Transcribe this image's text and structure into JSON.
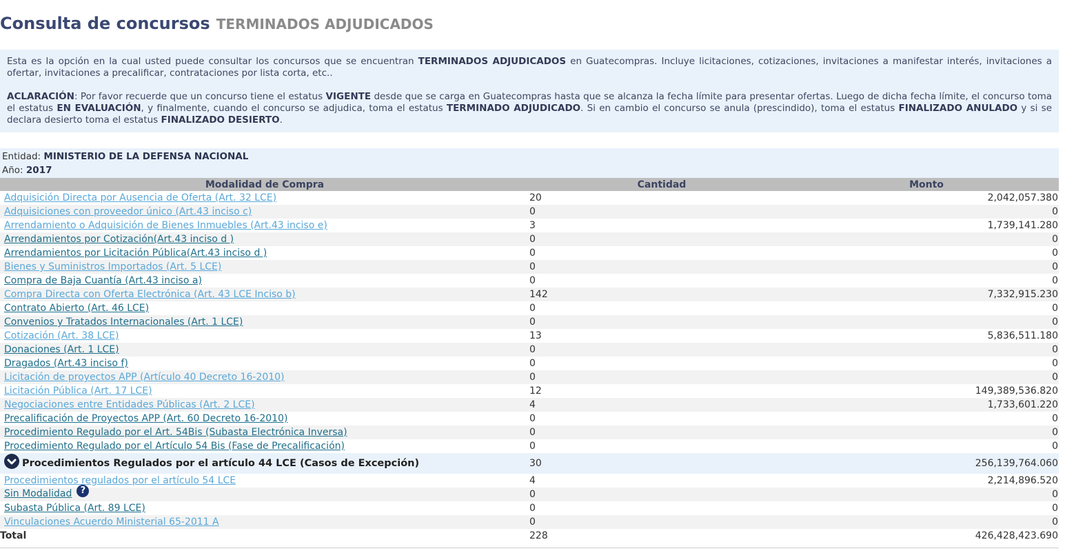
{
  "header": {
    "title": "Consulta de concursos",
    "subtitle": "TERMINADOS ADJUDICADOS"
  },
  "info": {
    "p1_a": "Esta es la opción en la cual usted puede consultar los concursos que se encuentran ",
    "p1_b": "TERMINADOS ADJUDICADOS",
    "p1_c": " en Guatecompras. Incluye licitaciones, cotizaciones, invitaciones a manifestar interés, invitaciones a ofertar, invitaciones a precalificar, contrataciones por lista corta, etc..",
    "p2_a": "ACLARACIÓN",
    "p2_b": ": Por favor recuerde que un concurso tiene el estatus ",
    "p2_c": "VIGENTE",
    "p2_d": " desde que se carga en Guatecompras hasta que se alcanza la fecha límite para presentar ofertas. Luego de dicha fecha límite, el concurso toma el estatus ",
    "p2_e": "EN EVALUACIÓN",
    "p2_f": ", y finalmente, cuando el concurso se adjudica, toma el estatus ",
    "p2_g": "TERMINADO ADJUDICADO",
    "p2_h": ". Si en cambio el concurso se anula (prescindido), toma el estatus ",
    "p2_i": "FINALIZADO ANULADO",
    "p2_j": " y si se declara desierto toma el estatus ",
    "p2_k": "FINALIZADO DESIERTO",
    "p2_l": "."
  },
  "meta": {
    "entity_label": "Entidad:",
    "entity_value": "MINISTERIO DE LA DEFENSA NACIONAL",
    "year_label": "Año:",
    "year_value": "2017"
  },
  "table": {
    "columns": [
      "Modalidad de Compra",
      "Cantidad",
      "Monto"
    ],
    "rows": [
      {
        "name": "Adquisición Directa por Ausencia de Oferta (Art. 32 LCE)",
        "qty": "20",
        "amount": "2,042,057.380",
        "style": "light"
      },
      {
        "name": "Adquisiciones con proveedor único (Art.43 inciso c)",
        "qty": "0",
        "amount": "0",
        "style": "light"
      },
      {
        "name": "Arrendamiento o Adquisición de Bienes Inmuebles (Art.43 inciso e)",
        "qty": "3",
        "amount": "1,739,141.280",
        "style": "light"
      },
      {
        "name": "Arrendamientos por Cotización(Art.43 inciso d )",
        "qty": "0",
        "amount": "0",
        "style": "dark"
      },
      {
        "name": "Arrendamientos por Licitación Pública(Art.43 inciso d )",
        "qty": "0",
        "amount": "0",
        "style": "dark"
      },
      {
        "name": "Bienes y Suministros Importados (Art. 5 LCE)",
        "qty": "0",
        "amount": "0",
        "style": "light"
      },
      {
        "name": "Compra de Baja Cuantía (Art.43 inciso a)",
        "qty": "0",
        "amount": "0",
        "style": "dark"
      },
      {
        "name": "Compra Directa con Oferta Electrónica (Art. 43 LCE Inciso b)",
        "qty": "142",
        "amount": "7,332,915.230",
        "style": "light"
      },
      {
        "name": "Contrato Abierto (Art. 46 LCE)",
        "qty": "0",
        "amount": "0",
        "style": "dark"
      },
      {
        "name": "Convenios y Tratados Internacionales (Art. 1 LCE)",
        "qty": "0",
        "amount": "0",
        "style": "dark"
      },
      {
        "name": "Cotización (Art. 38 LCE)",
        "qty": "13",
        "amount": "5,836,511.180",
        "style": "light"
      },
      {
        "name": "Donaciones (Art. 1 LCE)",
        "qty": "0",
        "amount": "0",
        "style": "dark"
      },
      {
        "name": "Dragados (Art.43 inciso f)",
        "qty": "0",
        "amount": "0",
        "style": "dark"
      },
      {
        "name": "Licitación de proyectos APP (Artículo 40 Decreto 16-2010)",
        "qty": "0",
        "amount": "0",
        "style": "light"
      },
      {
        "name": "Licitación Pública (Art. 17 LCE)",
        "qty": "12",
        "amount": "149,389,536.820",
        "style": "light"
      },
      {
        "name": "Negociaciones entre Entidades Públicas (Art. 2 LCE)",
        "qty": "4",
        "amount": "1,733,601.220",
        "style": "light"
      },
      {
        "name": "Precalificación de Proyectos APP (Art. 60 Decreto 16-2010)",
        "qty": "0",
        "amount": "0",
        "style": "dark"
      },
      {
        "name": "Procedimiento Regulado por el Art. 54Bis (Subasta Electrónica Inversa)",
        "qty": "0",
        "amount": "0",
        "style": "dark"
      },
      {
        "name": "Procedimiento Regulado por el Artículo 54 Bis (Fase de Precalificación)",
        "qty": "0",
        "amount": "0",
        "style": "dark"
      }
    ],
    "group": {
      "name": "Procedimientos Regulados por el artículo 44 LCE (Casos de Excepción)",
      "qty": "30",
      "amount": "256,139,764.060",
      "icon": "chevron-down-circle-icon"
    },
    "rows_after": [
      {
        "name": "Procedimientos regulados por el artículo 54 LCE",
        "qty": "4",
        "amount": "2,214,896.520",
        "style": "light"
      },
      {
        "name": "Sin Modalidad",
        "qty": "0",
        "amount": "0",
        "style": "dark",
        "help": "?"
      },
      {
        "name": "Subasta Pública (Art. 89 LCE)",
        "qty": "0",
        "amount": "0",
        "style": "dark"
      },
      {
        "name": "Vinculaciones Acuerdo Ministerial 65-2011 A",
        "qty": "0",
        "amount": "0",
        "style": "light"
      }
    ],
    "total": {
      "label": "Total",
      "qty": "228",
      "amount": "426,428,423.690"
    }
  }
}
